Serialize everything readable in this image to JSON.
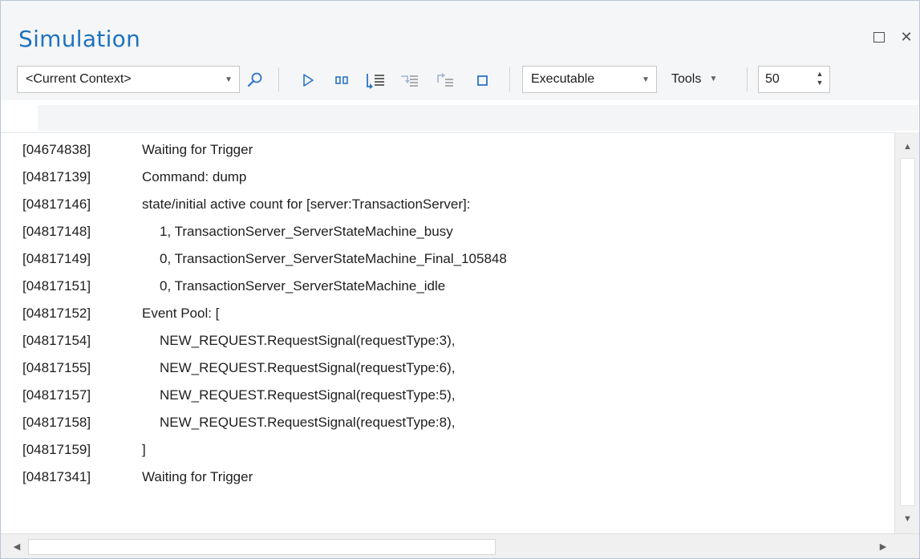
{
  "window": {
    "title": "Simulation",
    "close_glyph": "✕"
  },
  "toolbar": {
    "context_combo": {
      "value": "<Current Context>"
    },
    "icons": [
      "search-icon",
      "run-icon",
      "pause-icon",
      "step-into-icon",
      "step-over-icon",
      "step-out-icon",
      "stop-icon"
    ],
    "mode_combo": {
      "value": "Executable"
    },
    "tools_label": "Tools",
    "speed": {
      "value": "50"
    }
  },
  "colors": {
    "title": "#1e73be",
    "icon_blue": "#2b73c9",
    "background": "#f5f6f7"
  },
  "log": {
    "rows": [
      {
        "ts": "[04674838]",
        "msg": "Waiting for Trigger",
        "indent": 0
      },
      {
        "ts": "[04817139]",
        "msg": "Command: dump",
        "indent": 0
      },
      {
        "ts": "[04817146]",
        "msg": "state/initial active count for [server:TransactionServer]:",
        "indent": 0
      },
      {
        "ts": "[04817148]",
        "msg": "1, TransactionServer_ServerStateMachine_busy",
        "indent": 1
      },
      {
        "ts": "[04817149]",
        "msg": "0, TransactionServer_ServerStateMachine_Final_105848",
        "indent": 1
      },
      {
        "ts": "[04817151]",
        "msg": "0, TransactionServer_ServerStateMachine_idle",
        "indent": 1
      },
      {
        "ts": "[04817152]",
        "msg": "Event Pool: [",
        "indent": 0
      },
      {
        "ts": "[04817154]",
        "msg": "NEW_REQUEST.RequestSignal(requestType:3),",
        "indent": 1
      },
      {
        "ts": "[04817155]",
        "msg": "NEW_REQUEST.RequestSignal(requestType:6),",
        "indent": 1
      },
      {
        "ts": "[04817157]",
        "msg": "NEW_REQUEST.RequestSignal(requestType:5),",
        "indent": 1
      },
      {
        "ts": "[04817158]",
        "msg": "NEW_REQUEST.RequestSignal(requestType:8),",
        "indent": 1
      },
      {
        "ts": "[04817159]",
        "msg": "]",
        "indent": 0
      },
      {
        "ts": "[04817341]",
        "msg": "Waiting for Trigger",
        "indent": 0
      }
    ]
  }
}
